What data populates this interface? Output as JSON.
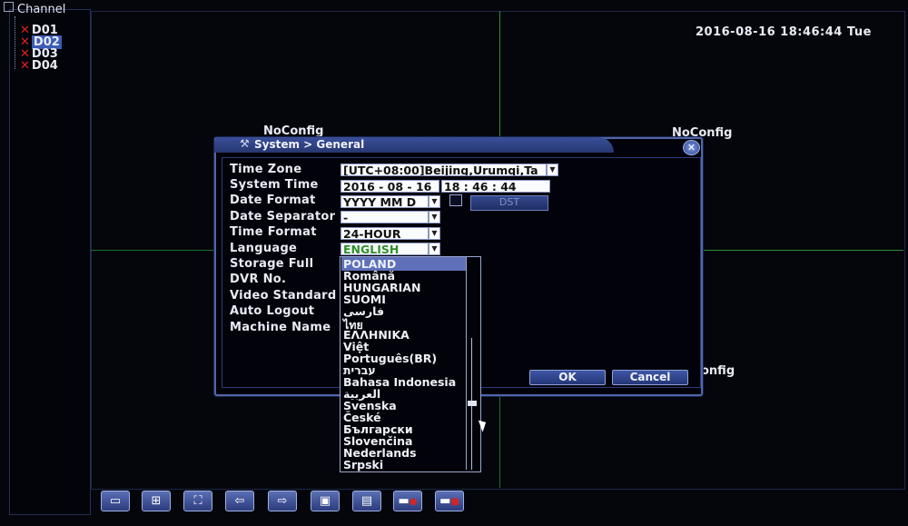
{
  "channel_tree": {
    "root_label": "Channel",
    "items": [
      {
        "label": "D01",
        "selected": false
      },
      {
        "label": "D02",
        "selected": true
      },
      {
        "label": "D03",
        "selected": false
      },
      {
        "label": "D04",
        "selected": false
      }
    ]
  },
  "clock": "2016-08-16 18:46:44 Tue",
  "video_tiles": {
    "tile1": "NoConfig",
    "tile2": "NoConfig",
    "tile4": "onfig"
  },
  "dialog": {
    "title": "System > General",
    "close_glyph": "✕",
    "labels": {
      "time_zone": "Time Zone",
      "system_time": "System Time",
      "date_format": "Date Format",
      "date_separator": "Date Separator",
      "time_format": "Time Format",
      "language": "Language",
      "storage_full": "Storage Full",
      "dvr_no": "DVR No.",
      "video_standard": "Video Standard",
      "auto_logout": "Auto Logout",
      "machine_name": "Machine Name"
    },
    "values": {
      "time_zone": "[UTC+08:00]Beijing,Urumqi,Ta",
      "system_date": "2016 - 08 - 16",
      "system_clock": "18 : 46 : 44",
      "date_format": "YYYY MM D",
      "date_separator": "-",
      "time_format": "24-HOUR",
      "language": "ENGLISH"
    },
    "dst_label": "DST",
    "ok_label": "OK",
    "cancel_label": "Cancel"
  },
  "language_options": [
    "POLAND",
    "Română",
    "HUNGARIAN",
    "SUOMI",
    "فارسی",
    "ไทย",
    "ΕΛΛΗΝΙΚΑ",
    "Việt",
    "Português(BR)",
    "עברית",
    "Bahasa Indonesia",
    "العربية",
    "Svenska",
    "České",
    "Български",
    "Slovenčina",
    "Nederlands",
    "Srpski"
  ],
  "language_selected_index": 0,
  "colors": {
    "grid_green": "#2c8e38",
    "dialog_blue": "#3a4f9a",
    "error_red": "#e0211c",
    "language_green": "#2f8f2c"
  },
  "toolbar_icons": [
    "single-view-icon",
    "quad-view-icon",
    "fullscreen-icon",
    "prev-arrow-icon",
    "next-arrow-icon",
    "monitor-play-icon",
    "monitor-search-icon",
    "record-icon",
    "stop-record-icon"
  ]
}
